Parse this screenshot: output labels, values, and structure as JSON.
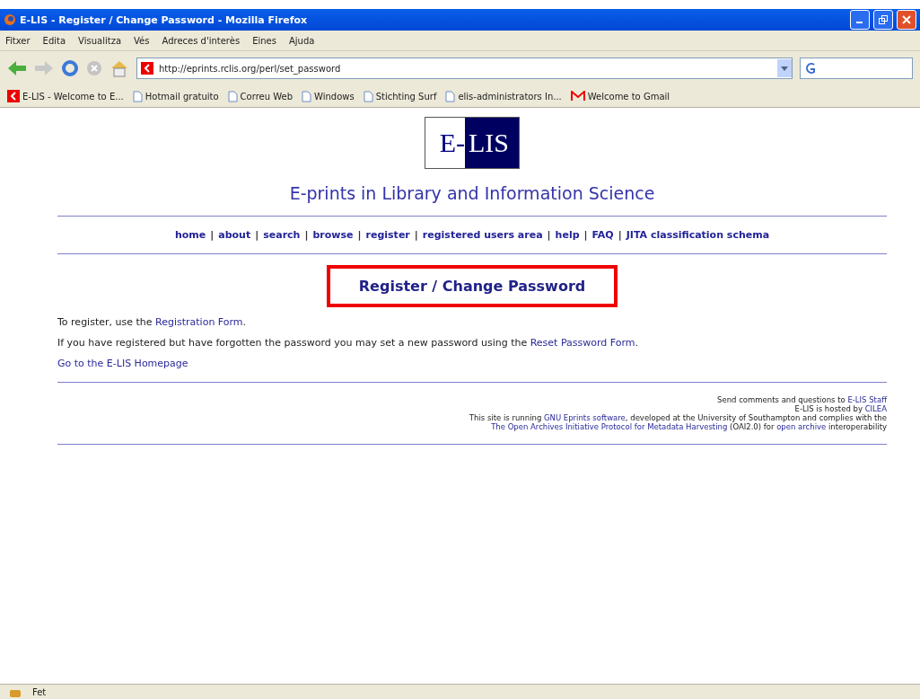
{
  "window": {
    "title": "E-LIS - Register / Change Password - Mozilla Firefox"
  },
  "menu": [
    "Fitxer",
    "Edita",
    "Visualitza",
    "Vés",
    "Adreces d'interès",
    "Eines",
    "Ajuda"
  ],
  "address": {
    "value": "http://eprints.rclis.org/perl/set_password"
  },
  "bookmarks": [
    {
      "label": "E-LIS - Welcome to E...",
      "kind": "site"
    },
    {
      "label": "Hotmail gratuito",
      "kind": "page"
    },
    {
      "label": "Correu Web",
      "kind": "page"
    },
    {
      "label": "Windows",
      "kind": "page"
    },
    {
      "label": "Stichting Surf",
      "kind": "page"
    },
    {
      "label": "elis-administrators In...",
      "kind": "page"
    },
    {
      "label": "Welcome to Gmail",
      "kind": "mail"
    }
  ],
  "page": {
    "logo": [
      "E-",
      "LIS"
    ],
    "site_title": "E-prints in Library and Information Science",
    "nav_separator": "|",
    "nav": [
      "home",
      "about",
      "search",
      "browse",
      "register",
      "registered users area",
      "help",
      "FAQ",
      "JITA classification schema"
    ],
    "heading": "Register / Change Password",
    "paragraphs": [
      [
        {
          "kind": "text",
          "text": "To register, use the "
        },
        {
          "kind": "link",
          "text": "Registration Form"
        },
        {
          "kind": "text",
          "text": "."
        }
      ],
      [
        {
          "kind": "text",
          "text": "If you have registered but have forgotten the password you may set a new password using the "
        },
        {
          "kind": "link",
          "text": "Reset Password Form"
        },
        {
          "kind": "text",
          "text": "."
        }
      ],
      [
        {
          "kind": "link",
          "text": "Go to the E-LIS Homepage"
        }
      ]
    ],
    "footer": [
      [
        {
          "kind": "text",
          "text": "Send comments and questions to "
        },
        {
          "kind": "link",
          "text": "E-LIS Staff"
        }
      ],
      [
        {
          "kind": "text",
          "text": "E-LIS is hosted by "
        },
        {
          "kind": "link",
          "text": "CILEA"
        }
      ],
      [
        {
          "kind": "text",
          "text": "This site is running "
        },
        {
          "kind": "link",
          "text": "GNU Eprints software"
        },
        {
          "kind": "text",
          "text": ", developed at the University of Southampton and complies with the"
        }
      ],
      [
        {
          "kind": "link",
          "text": "The Open Archives Initiative Protocol for Metadata Harvesting"
        },
        {
          "kind": "text",
          "text": " (OAI2.0) for "
        },
        {
          "kind": "link",
          "text": "open archive"
        },
        {
          "kind": "text",
          "text": " interoperability"
        }
      ]
    ]
  },
  "status_bar": {
    "text": "Fet"
  }
}
